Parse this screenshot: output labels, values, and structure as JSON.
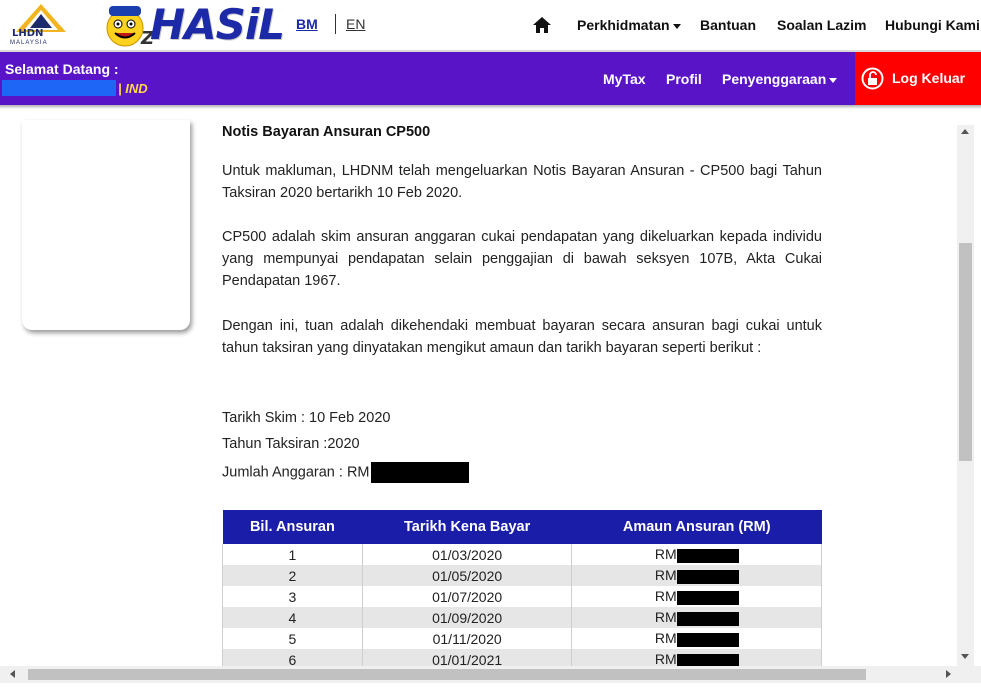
{
  "header": {
    "lhdn_logo_text": "LHDN",
    "lhdn_logo_subtext": "MALAYSIA",
    "brand_text": "HASiL",
    "lang_bm": "BM",
    "lang_en": "EN",
    "nav": [
      {
        "label": "Perkhidmatan",
        "has_dropdown": true
      },
      {
        "label": "Bantuan",
        "has_dropdown": false
      },
      {
        "label": "Soalan Lazim",
        "has_dropdown": false
      },
      {
        "label": "Hubungi Kami",
        "has_dropdown": false
      }
    ]
  },
  "userbar": {
    "welcome": "Selamat Datang :",
    "user_type": "| IND",
    "nav": [
      {
        "label": "MyTax"
      },
      {
        "label": "Profil"
      },
      {
        "label": "Penyenggaraan",
        "has_dropdown": true
      }
    ],
    "logout_label": "Log Keluar"
  },
  "notice": {
    "title": "Notis Bayaran Ansuran CP500",
    "para1": "Untuk makluman, LHDNM telah mengeluarkan Notis Bayaran Ansuran - CP500 bagi Tahun Taksiran 2020  bertarikh 10 Feb 2020.",
    "para2": "CP500 adalah skim ansuran anggaran cukai pendapatan yang dikeluarkan kepada individu yang mempunyai pendapatan selain penggajian di bawah seksyen 107B, Akta Cukai Pendapatan 1967.",
    "para3": "Dengan ini, tuan adalah dikehendaki membuat bayaran secara ansuran bagi cukai untuk tahun taksiran yang dinyatakan mengikut amaun dan tarikh bayaran seperti berikut :",
    "tarikh_skim": "Tarikh Skim : 10 Feb 2020",
    "tahun_taksiran": "Tahun Taksiran :2020",
    "jumlah_anggaran": "Jumlah Anggaran : RM"
  },
  "table": {
    "headers": [
      "Bil. Ansuran",
      "Tarikh Kena Bayar",
      "Amaun Ansuran (RM)"
    ],
    "rows": [
      {
        "no": "1",
        "date": "01/03/2020",
        "amount_prefix": "RM"
      },
      {
        "no": "2",
        "date": "01/05/2020",
        "amount_prefix": "RM"
      },
      {
        "no": "3",
        "date": "01/07/2020",
        "amount_prefix": "RM"
      },
      {
        "no": "4",
        "date": "01/09/2020",
        "amount_prefix": "RM"
      },
      {
        "no": "5",
        "date": "01/11/2020",
        "amount_prefix": "RM"
      },
      {
        "no": "6",
        "date": "01/01/2021",
        "amount_prefix": "RM"
      }
    ]
  },
  "colors": {
    "purple_bar": "#5a14c8",
    "logout_red": "#ff0000",
    "table_header": "#1a1da8"
  }
}
